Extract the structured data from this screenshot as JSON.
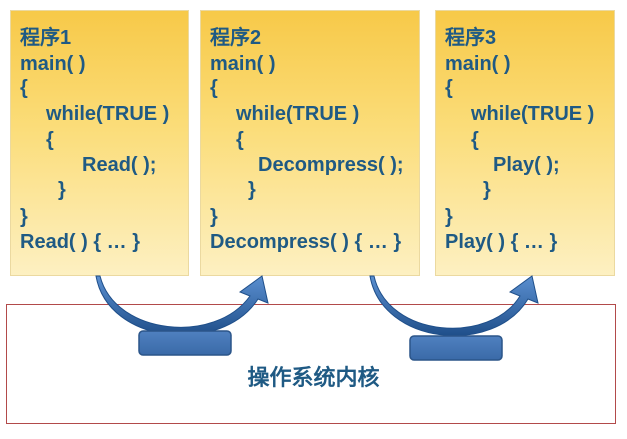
{
  "programs": [
    {
      "title": "程序1",
      "lines": [
        "main( )",
        "{",
        "while(TRUE )",
        "{",
        "Read( );",
        "}",
        "}",
        "Read( ) { … }"
      ]
    },
    {
      "title": "程序2",
      "lines": [
        "main( )",
        "{",
        "while(TRUE )",
        "{",
        "Decompress( );",
        "}",
        "}",
        "Decompress( ) { … }"
      ]
    },
    {
      "title": "程序3",
      "lines": [
        "main( )",
        "{",
        "while(TRUE )",
        "{",
        "Play( );",
        "}",
        "}",
        "Play( ) { … }"
      ]
    }
  ],
  "kernel": {
    "label": "操作系统内核"
  },
  "colors": {
    "box_top": "#f7c948",
    "box_bottom": "#fdf0c2",
    "code_text": "#1f5a84",
    "arrow": "#2f66a6",
    "kernel_border": "#b24a4a"
  }
}
